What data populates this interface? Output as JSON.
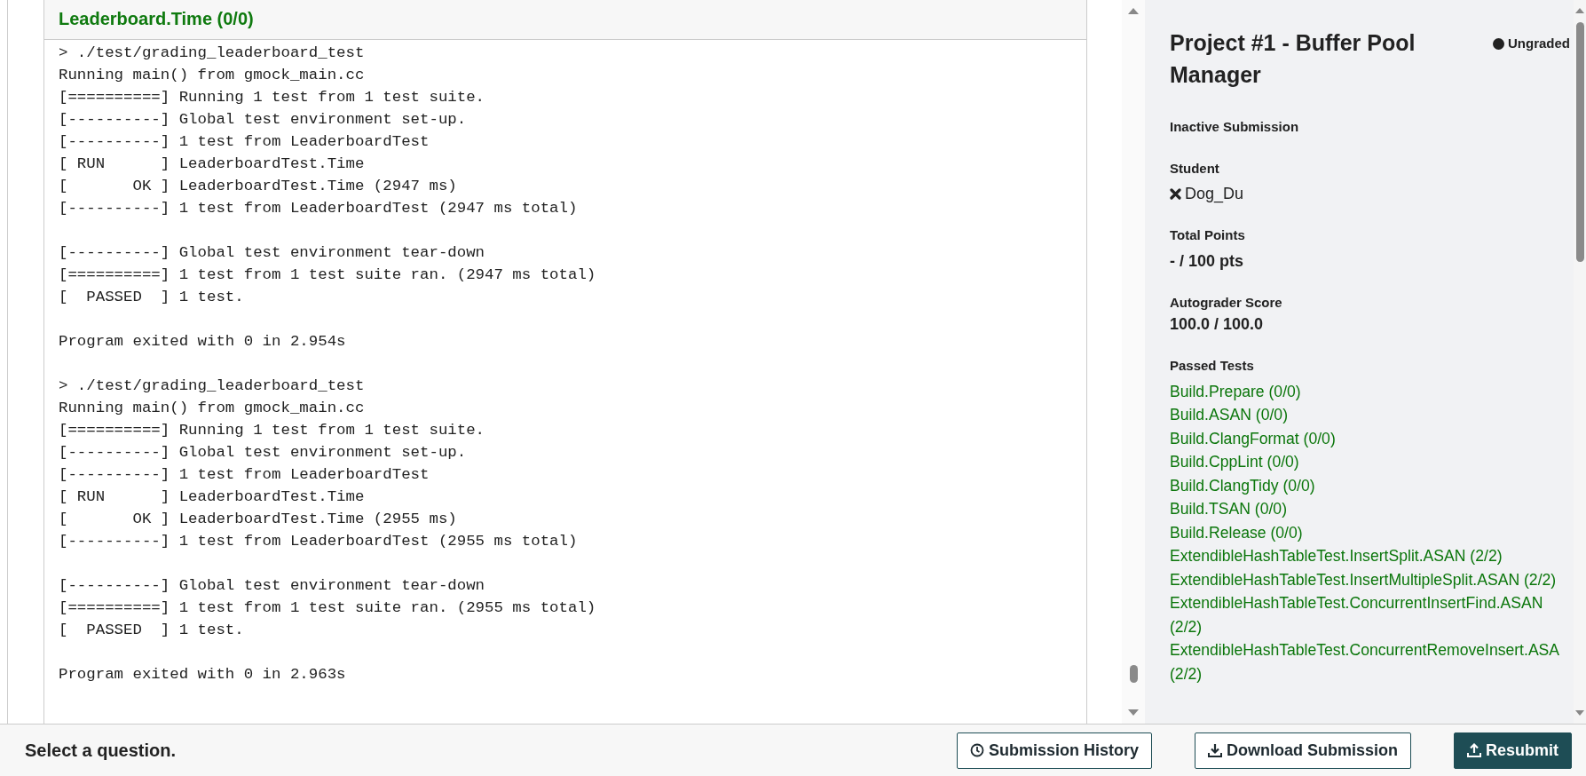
{
  "question": {
    "title": "Leaderboard.Time (0/0)",
    "runs": [
      {
        "blocks": [
          [
            "> ./test/grading_leaderboard_test",
            "Running main() from gmock_main.cc",
            "[==========] Running 1 test from 1 test suite.",
            "[----------] Global test environment set-up.",
            "[----------] 1 test from LeaderboardTest",
            "[ RUN      ] LeaderboardTest.Time",
            "[       OK ] LeaderboardTest.Time (2947 ms)",
            "[----------] 1 test from LeaderboardTest (2947 ms total)"
          ],
          [
            "[----------] Global test environment tear-down",
            "[==========] 1 test from 1 test suite ran. (2947 ms total)",
            "[  PASSED  ] 1 test."
          ],
          [
            "Program exited with 0 in 2.954s"
          ]
        ]
      },
      {
        "blocks": [
          [
            "> ./test/grading_leaderboard_test",
            "Running main() from gmock_main.cc",
            "[==========] Running 1 test from 1 test suite.",
            "[----------] Global test environment set-up.",
            "[----------] 1 test from LeaderboardTest",
            "[ RUN      ] LeaderboardTest.Time",
            "[       OK ] LeaderboardTest.Time (2955 ms)",
            "[----------] 1 test from LeaderboardTest (2955 ms total)"
          ],
          [
            "[----------] Global test environment tear-down",
            "[==========] 1 test from 1 test suite ran. (2955 ms total)",
            "[  PASSED  ] 1 test."
          ],
          [
            "Program exited with 0 in 2.963s"
          ]
        ]
      }
    ]
  },
  "submission": {
    "title": "Project #1 - Buffer Pool Manager",
    "status": "Ungraded",
    "inactive_label": "Inactive Submission",
    "student_label": "Student",
    "student": "Dog_Du",
    "total_points_label": "Total Points",
    "total_points": "- / 100 pts",
    "autograder_label": "Autograder Score",
    "autograder_score": "100.0 / 100.0",
    "passed_label": "Passed Tests",
    "passed_tests": [
      "Build.Prepare (0/0)",
      "Build.ASAN (0/0)",
      "Build.ClangFormat (0/0)",
      "Build.CppLint (0/0)",
      "Build.ClangTidy (0/0)",
      "Build.TSAN (0/0)",
      "Build.Release (0/0)",
      "ExtendibleHashTableTest.InsertSplit.ASAN (2/2)",
      "ExtendibleHashTableTest.InsertMultipleSplit.ASAN (2/2)",
      "ExtendibleHashTableTest.ConcurrentInsertFind.ASAN (2/2)",
      "ExtendibleHashTableTest.ConcurrentRemoveInsert.ASA (2/2)"
    ]
  },
  "footer": {
    "prompt": "Select a question.",
    "buttons": [
      {
        "label": "Submission History",
        "kind": "history"
      },
      {
        "label": "Download Submission",
        "kind": "download"
      },
      {
        "label": "Resubmit",
        "kind": "resubmit"
      }
    ]
  }
}
